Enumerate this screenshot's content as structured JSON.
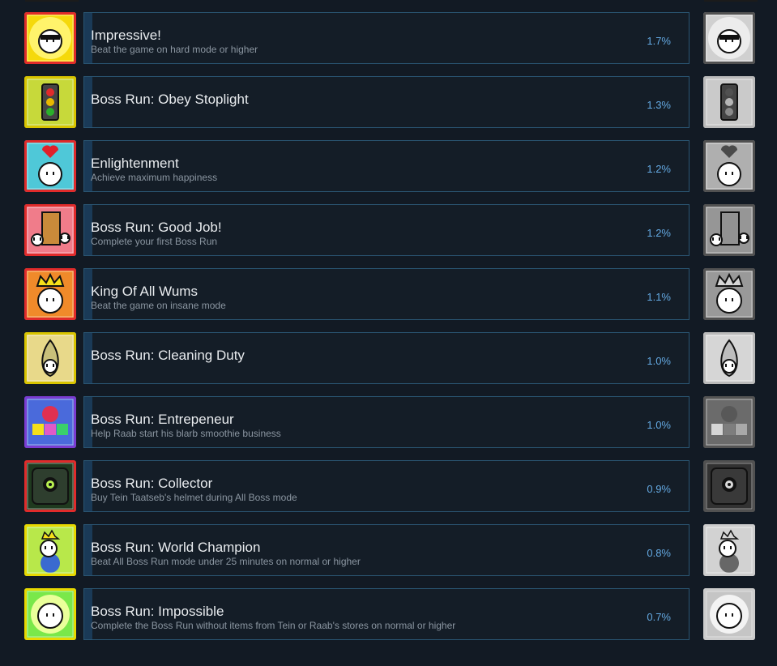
{
  "achievements": [
    {
      "title": "Impressive!",
      "description": "Beat the game on hard mode or higher",
      "percent": "1.7%",
      "progress": 1,
      "icon": "sunglasses-wum-icon",
      "color": "#f5d90a",
      "border": "#e02b2b"
    },
    {
      "title": "Boss Run: Obey Stoplight",
      "description": "",
      "percent": "1.3%",
      "progress": 1,
      "icon": "stoplight-icon",
      "color": "#c7d93a",
      "border": "#d8c400"
    },
    {
      "title": "Enlightenment",
      "description": "Achieve maximum happiness",
      "percent": "1.2%",
      "progress": 1,
      "icon": "heart-wum-icon",
      "color": "#4fc8d8",
      "border": "#e02b2b"
    },
    {
      "title": "Boss Run: Good Job!",
      "description": "Complete your first Boss Run",
      "percent": "1.2%",
      "progress": 1,
      "icon": "door-party-icon",
      "color": "#f07c8a",
      "border": "#e02b2b"
    },
    {
      "title": "King Of All Wums",
      "description": "Beat the game on insane mode",
      "percent": "1.1%",
      "progress": 1,
      "icon": "crown-wum-icon",
      "color": "#f08a2a",
      "border": "#e02b2b"
    },
    {
      "title": "Boss Run: Cleaning Duty",
      "description": "",
      "percent": "1.0%",
      "progress": 1,
      "icon": "pear-wum-icon",
      "color": "#e8d98a",
      "border": "#d8c400"
    },
    {
      "title": "Boss Run: Entrepeneur",
      "description": "Help Raab start his blarb smoothie business",
      "percent": "1.0%",
      "progress": 1,
      "icon": "smoothie-blocks-icon",
      "color": "#4a6adb",
      "border": "#7a3cd0"
    },
    {
      "title": "Boss Run: Collector",
      "description": "Buy Tein Taatseb's helmet during All Boss mode",
      "percent": "0.9%",
      "progress": 1,
      "icon": "eye-helmet-icon",
      "color": "#1f3a1f",
      "border": "#e02b2b"
    },
    {
      "title": "Boss Run: World Champion",
      "description": "Beat All Boss Run mode under 25 minutes on normal or higher",
      "percent": "0.8%",
      "progress": 1,
      "icon": "champion-wum-icon",
      "color": "#b8e84a",
      "border": "#e8d800"
    },
    {
      "title": "Boss Run: Impossible",
      "description": "Complete the Boss Run without items from Tein or Raab's stores on normal or higher",
      "percent": "0.7%",
      "progress": 1,
      "icon": "sun-wum-icon",
      "color": "#7ae84a",
      "border": "#e8d800"
    }
  ]
}
